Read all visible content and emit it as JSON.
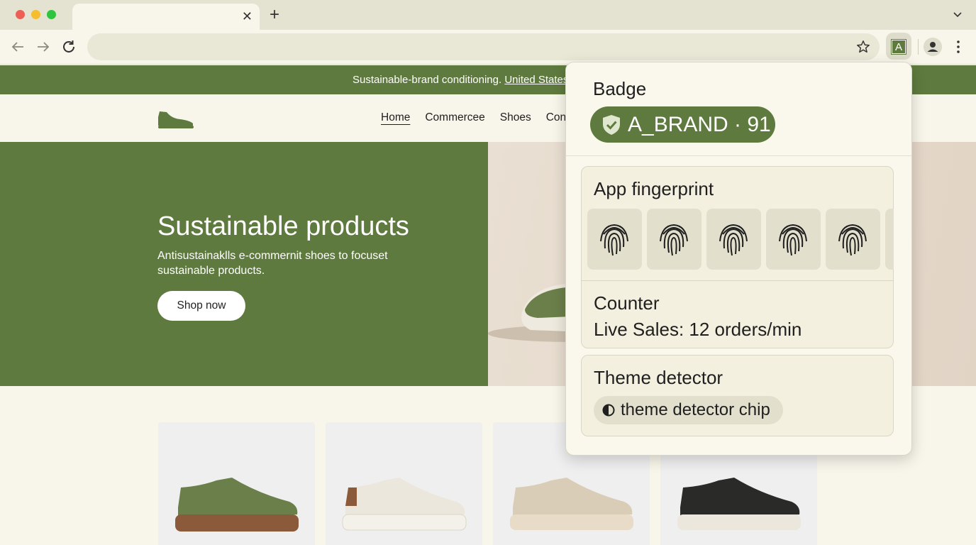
{
  "browser": {
    "tab_close_glyph": "✕",
    "new_tab_glyph": "+",
    "extension_letter": "A",
    "icons": [
      "back-arrow-icon",
      "forward-arrow-icon",
      "reload-icon",
      "star-icon",
      "profile-icon",
      "kebab-menu-icon",
      "chevron-down-icon"
    ]
  },
  "page": {
    "announcement": {
      "text": "Sustainable-brand conditioning. ",
      "link": "United States"
    },
    "nav": [
      "Home",
      "Commercee",
      "Shoes",
      "Con"
    ],
    "hero": {
      "title": "Sustainable products",
      "subtitle": "Antisustainaklls e-commernit shoes to focuset sustainable products.",
      "button": "Shop now"
    },
    "products": [
      {
        "name": "green sneaker",
        "color": "#6b7f4a",
        "sole": "#8a5a3a"
      },
      {
        "name": "cream sneaker",
        "color": "#ece7dc",
        "sole": "#f4f1ea"
      },
      {
        "name": "beige sneaker",
        "color": "#d9cdb7",
        "sole": "#e8dcc8"
      },
      {
        "name": "black sneaker",
        "color": "#2a2a28",
        "sole": "#ece7dc"
      }
    ],
    "colors": {
      "brand_green": "#5f7a3e",
      "background": "#f8f6ea"
    }
  },
  "popup": {
    "badge": {
      "title": "Badge",
      "label": "A_BRAND · 91"
    },
    "fingerprint": {
      "title": "App fingerprint",
      "tile_count": 6
    },
    "counter": {
      "title": "Counter",
      "value": "Live Sales:  12 orders/min"
    },
    "theme": {
      "title": "Theme detector",
      "chip": "theme detector chip"
    }
  }
}
